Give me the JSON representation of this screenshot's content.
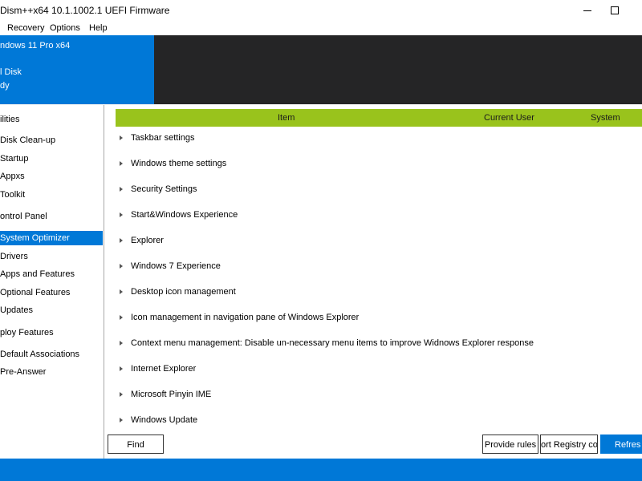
{
  "window": {
    "title": "Dism++x64 10.1.1002.1 UEFI Firmware"
  },
  "menu": {
    "items": [
      {
        "label": "Recovery"
      },
      {
        "label": "Options"
      },
      {
        "label": "Help"
      }
    ]
  },
  "header": {
    "os_name": "ndows 11 Pro x64",
    "disk": "l Disk",
    "status": "dy"
  },
  "sidebar": {
    "items": [
      {
        "label": "ilities"
      },
      {
        "label": "Disk Clean-up"
      },
      {
        "label": "Startup"
      },
      {
        "label": "Appxs"
      },
      {
        "label": "Toolkit"
      },
      {
        "label": "ontrol Panel"
      },
      {
        "label": "System Optimizer",
        "selected": true
      },
      {
        "label": "Drivers"
      },
      {
        "label": "Apps and Features"
      },
      {
        "label": "Optional Features"
      },
      {
        "label": "Updates"
      },
      {
        "label": "ploy Features"
      },
      {
        "label": "Default Associations"
      },
      {
        "label": "Pre-Answer"
      }
    ]
  },
  "table": {
    "columns": {
      "item": "Item",
      "current_user": "Current User",
      "system": "System"
    },
    "rows": [
      {
        "label": "Taskbar settings"
      },
      {
        "label": "Windows theme settings"
      },
      {
        "label": "Security Settings"
      },
      {
        "label": "Start&Windows Experience"
      },
      {
        "label": "Explorer"
      },
      {
        "label": "Windows 7 Experience"
      },
      {
        "label": "Desktop icon management"
      },
      {
        "label": "Icon management in navigation pane of Windows Explorer"
      },
      {
        "label": "Context menu management: Disable un-necessary menu items to improve Widnows Explorer response"
      },
      {
        "label": "Internet Explorer"
      },
      {
        "label": "Microsoft Pinyin IME"
      },
      {
        "label": "Windows Update"
      }
    ]
  },
  "buttons": {
    "find": "Find",
    "provide_rules": "Provide rules",
    "import_registry": "ort Registry co",
    "refresh": "Refresh"
  },
  "colors": {
    "accent": "#0078d7",
    "header_green": "#99c31c",
    "dark_panel": "#252526"
  }
}
